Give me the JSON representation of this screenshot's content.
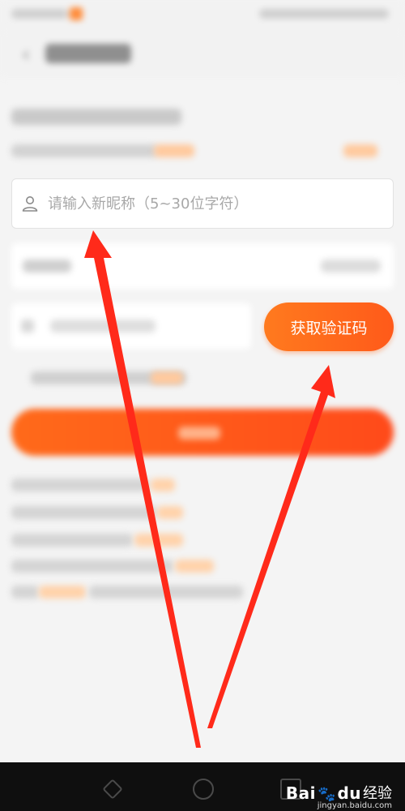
{
  "form": {
    "nickname_input": {
      "placeholder": "请输入新昵称（5~30位字符）",
      "value": ""
    },
    "get_code_button": {
      "label": "获取验证码"
    }
  },
  "colors": {
    "accent": "#ff6a1e",
    "arrow": "#ff2a1a",
    "background": "#f4f4f4"
  },
  "icons": {
    "back": "back-arrow-icon",
    "nickname": "person-icon"
  },
  "watermark": {
    "brand": "Bai",
    "brand_suffix": "du",
    "title": "经验",
    "url": "jingyan.baidu.com"
  }
}
